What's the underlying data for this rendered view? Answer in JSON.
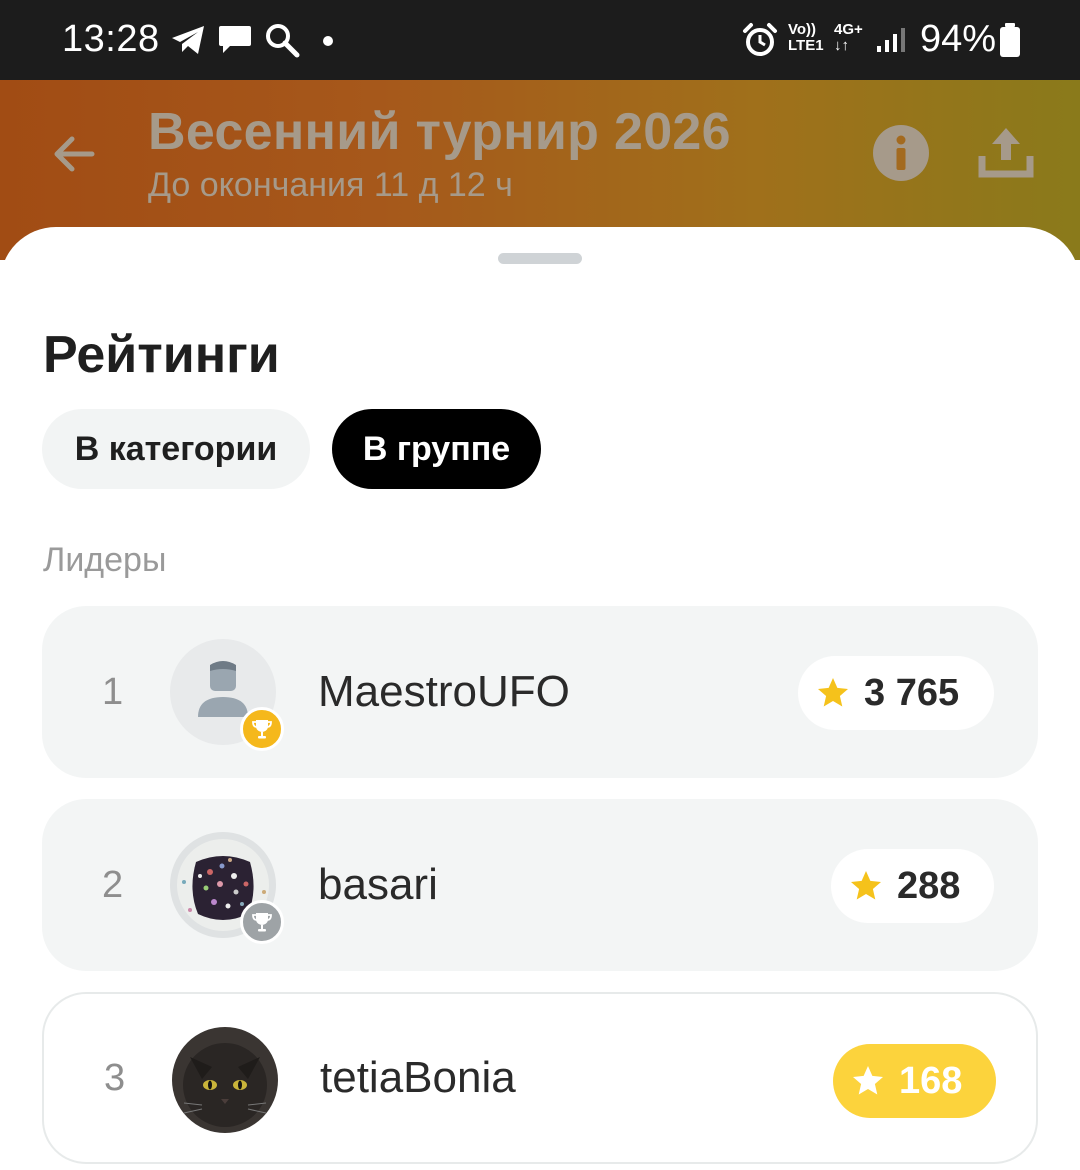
{
  "status_bar": {
    "time": "13:28",
    "network_top": "Vo))",
    "network_bottom": "LTE1",
    "gen_top": "4G+",
    "gen_bottom": "↓↑",
    "battery": "94%"
  },
  "header": {
    "title": "Весенний турнир 2026",
    "subtitle": "До окончания 11 д 12 ч"
  },
  "sheet": {
    "title": "Рейтинги",
    "tabs": [
      {
        "label": "В категории",
        "active": false
      },
      {
        "label": "В группе",
        "active": true
      }
    ],
    "section_label": "Лидеры",
    "leaders": [
      {
        "rank": "1",
        "name": "MaestroUFO",
        "score": "3 765",
        "trophy": "gold"
      },
      {
        "rank": "2",
        "name": "basari",
        "score": "288",
        "trophy": "silver"
      },
      {
        "rank": "3",
        "name": "tetiaBonia",
        "score": "168",
        "trophy": "none"
      }
    ]
  },
  "colors": {
    "accent": "#fcd33c",
    "star": "#f5c21b",
    "active_tab": "#000000",
    "header_gradient_start": "#a14c14",
    "header_gradient_end": "#8a7a1b"
  }
}
